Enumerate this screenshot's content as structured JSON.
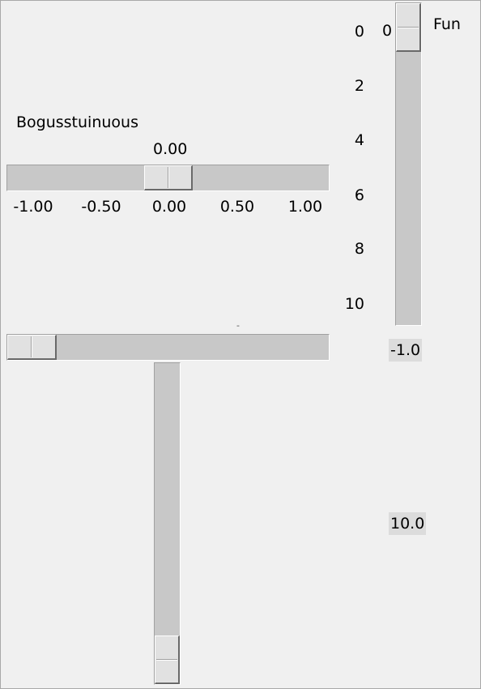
{
  "slider_a": {
    "label": "Bogusstuinuous",
    "value": "0.00",
    "from": -1.0,
    "to": 1.0,
    "current": 0.0,
    "ticks": [
      "-1.00",
      "-0.50",
      "0.00",
      "0.50",
      "1.00"
    ]
  },
  "slider_fun": {
    "label": "Fun",
    "value": "0",
    "from": 0,
    "to": 10,
    "current": 0,
    "ticks": [
      "0",
      "2",
      "4",
      "6",
      "8",
      "10"
    ]
  },
  "slider_b": {
    "from": -1.0,
    "to": 10.0,
    "current": -1.0,
    "mark": "-"
  },
  "slider_c": {
    "from_label": "-1.0",
    "to_label": "10.0",
    "from": -1.0,
    "to": 10.0,
    "current": 10.0
  }
}
